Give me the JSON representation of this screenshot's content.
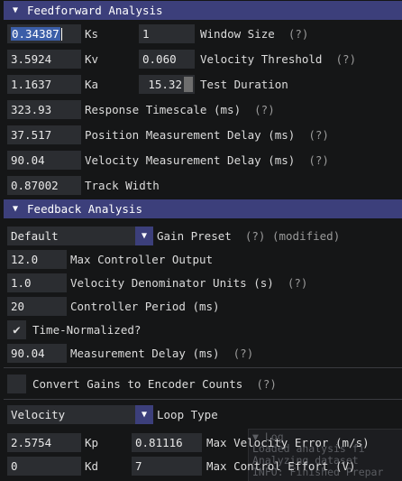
{
  "feedforward": {
    "title": "Feedforward Analysis",
    "ks_value": "0.34387",
    "ks_label": "Ks",
    "window_size_value": "1",
    "window_size_label": "Window Size",
    "kv_value": "3.5924",
    "kv_label": "Kv",
    "velocity_threshold_value": "0.060",
    "velocity_threshold_label": "Velocity Threshold",
    "ka_value": "1.1637",
    "ka_label": "Ka",
    "test_duration_value": "15.32",
    "test_duration_label": "Test Duration",
    "response_timescale_value": "323.93",
    "response_timescale_label": "Response Timescale (ms)",
    "position_delay_value": "37.517",
    "position_delay_label": "Position Measurement Delay (ms)",
    "velocity_delay_value": "90.04",
    "velocity_delay_label": "Velocity Measurement Delay (ms)",
    "track_width_value": "0.87002",
    "track_width_label": "Track Width"
  },
  "feedback": {
    "title": "Feedback Analysis",
    "gain_preset_value": "Default",
    "gain_preset_label": "Gain Preset",
    "modified_label": "(modified)",
    "max_output_value": "12.0",
    "max_output_label": "Max Controller Output",
    "vel_denominator_value": "1.0",
    "vel_denominator_label": "Velocity Denominator Units (s)",
    "controller_period_value": "20",
    "controller_period_label": "Controller Period (ms)",
    "time_normalized_label": "Time-Normalized?",
    "time_normalized_checked": true,
    "measurement_delay_value": "90.04",
    "measurement_delay_label": "Measurement Delay (ms)",
    "convert_gains_label": "Convert Gains to Encoder Counts",
    "convert_gains_checked": false,
    "loop_type_value": "Velocity",
    "loop_type_label": "Loop Type",
    "kp_value": "2.5754",
    "kp_label": "Kp",
    "max_velocity_error_value": "0.81116",
    "max_velocity_error_label": "Max Velocity Error (m/s)",
    "kd_value": "0",
    "kd_label": "Kd",
    "max_control_effort_value": "7",
    "max_control_effort_label": "Max Control Effort (V)"
  },
  "help_marker": "(?)",
  "icons": {
    "collapse": "triangle-down",
    "combo": "triangle-down",
    "check": "checkmark"
  },
  "colors": {
    "background": "#151617",
    "header": "#3c3f7b",
    "field": "#2b2d31",
    "selection": "#3b5ea8",
    "text": "#dcdcdc",
    "muted": "#9a9a9a"
  },
  "log": {
    "lines": [
      "▼ Log",
      "  Loaded analysis fi",
      "  Analyzing dataset",
      "INFO: Finished Prepar"
    ]
  }
}
